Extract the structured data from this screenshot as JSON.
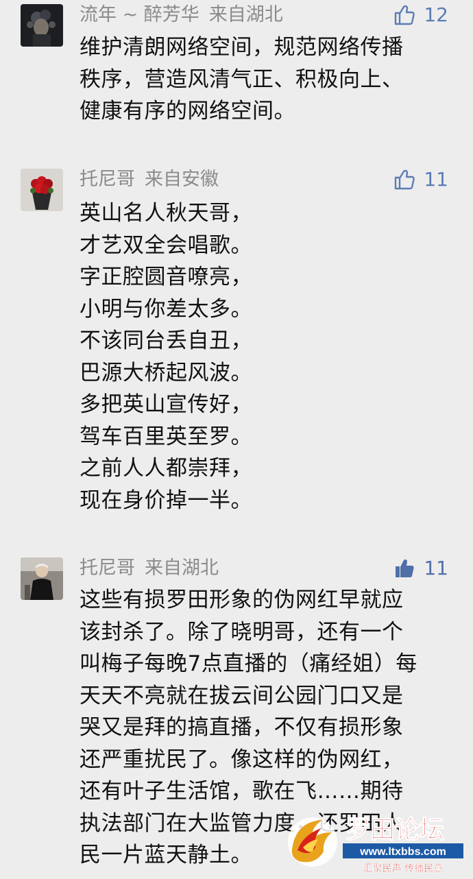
{
  "comments": [
    {
      "user": "流年 ~ 醉芳华",
      "location": "来自湖北",
      "likes": "12",
      "liked": false,
      "lines": [
        "维护清朗网络空间，规范网络传播",
        "秩序，营造风清气正、积极向上、",
        "健康有序的网络空间。"
      ]
    },
    {
      "user": "托尼哥",
      "location": "来自安徽",
      "likes": "11",
      "liked": false,
      "lines": [
        "英山名人秋天哥，",
        "才艺双全会唱歌。",
        "字正腔圆音嘹亮，",
        "小明与你差太多。",
        "不该同台丢自丑，",
        "巴源大桥起风波。",
        "多把英山宣传好，",
        "驾车百里英至罗。",
        "之前人人都崇拜，",
        "现在身价掉一半。"
      ]
    },
    {
      "user": "托尼哥",
      "location": "来自湖北",
      "likes": "11",
      "liked": true,
      "lines": [
        "这些有损罗田形象的伪网红早就应",
        "该封杀了。除了晓明哥，还有一个",
        "叫梅子每晚7点直播的（痛经姐）每",
        "天天不亮就在拔云间公园门口又是",
        "哭又是拜的搞直播，不仅有损形象",
        "还严重扰民了。像这样的伪网红，",
        "还有叶子生活馆，歌在飞……期待",
        "执法部门在大监管力度，还罗田人",
        "民一片蓝天静土。"
      ]
    }
  ],
  "watermark": {
    "brand": "罗田论坛",
    "url": "www.ltxbbs.com",
    "slogan": "汇聚民声 传播民意"
  },
  "colors": {
    "background": "#ededed",
    "name": "#8a8a8a",
    "like_outline": "#5b7cb5",
    "like_filled": "#4f6fa8",
    "text": "#111111",
    "brand_red": "#d8231b",
    "brand_blue": "#1c5aa6"
  },
  "icons": {
    "like": "thumbs-up-icon",
    "liked": "thumbs-up-filled-icon"
  }
}
